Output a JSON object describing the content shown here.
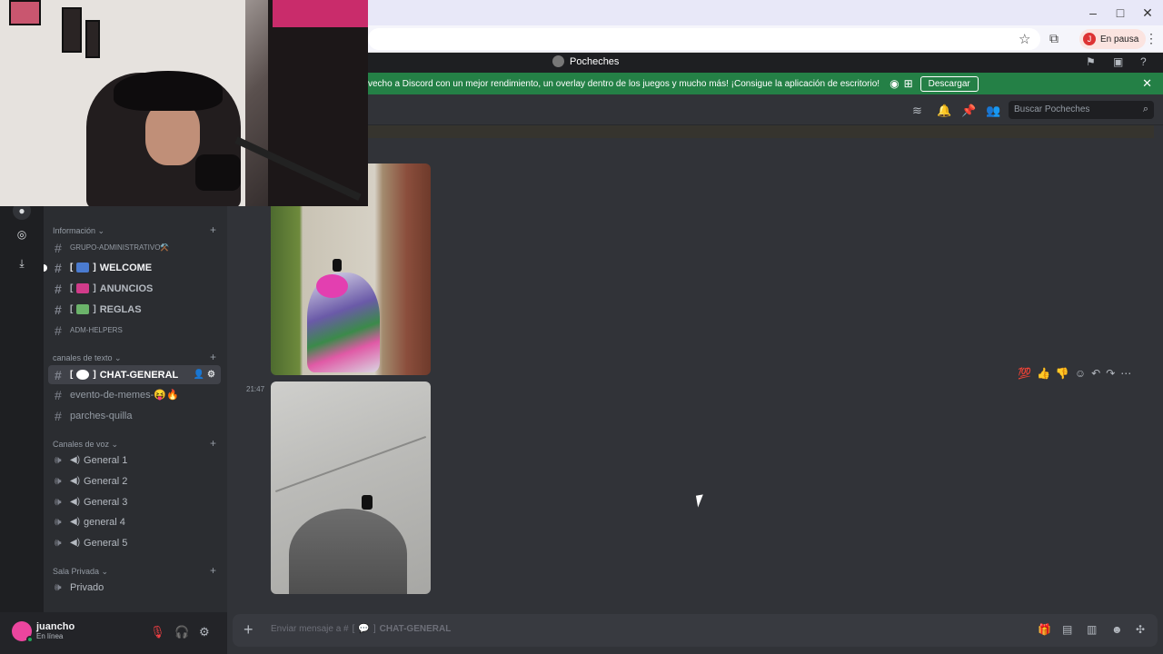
{
  "browser": {
    "profile_initial": "J",
    "profile_status": "En pausa",
    "window_controls": [
      "–",
      "□",
      "✕"
    ]
  },
  "titlebar": {
    "server_name": "Pocheches"
  },
  "promo": {
    "text": "vecho a Discord con un mejor rendimiento, un overlay dentro de los juegos y mucho más! ¡Consigue la aplicación de escritorio!",
    "button": "Descargar",
    "os_icons": [
      "apple-icon",
      "android-icon",
      "windows-icon"
    ]
  },
  "search": {
    "placeholder": "Buscar Pocheches"
  },
  "sidebar": {
    "categories": [
      {
        "label": "Información ⌄"
      },
      {
        "label": "canales de texto ⌄"
      },
      {
        "label": "Canales de voz ⌄"
      },
      {
        "label": "Sala Privada ⌄"
      }
    ],
    "channels": [
      {
        "label": "GRUPO-ADMINISTRATIVO⚒️"
      },
      {
        "bracket": "[",
        "label": "WELCOME"
      },
      {
        "bracket": "[",
        "label": "ANUNCIOS"
      },
      {
        "bracket": "[",
        "label": "REGLAS"
      },
      {
        "label": "ADM-HELPERS"
      },
      {
        "bracket": "[",
        "label": "CHAT-GENERAL"
      },
      {
        "label": "evento-de-memes-😝🔥"
      },
      {
        "label": "parches-quilla"
      }
    ],
    "voice": [
      {
        "label": "General 1"
      },
      {
        "label": "General 2"
      },
      {
        "label": "General 3"
      },
      {
        "label": "general 4"
      },
      {
        "label": "General 5"
      },
      {
        "label": "Privado"
      }
    ]
  },
  "user": {
    "name": "juancho",
    "status": "En línea"
  },
  "messages": {
    "timestamp": "21:47"
  },
  "composer": {
    "placeholder_prefix": "Enviar mensaje a #",
    "channel": "CHAT-GENERAL"
  },
  "colors": {
    "accent_green": "#248046",
    "bg_main": "#313338",
    "bg_sidebar": "#2b2d31"
  }
}
